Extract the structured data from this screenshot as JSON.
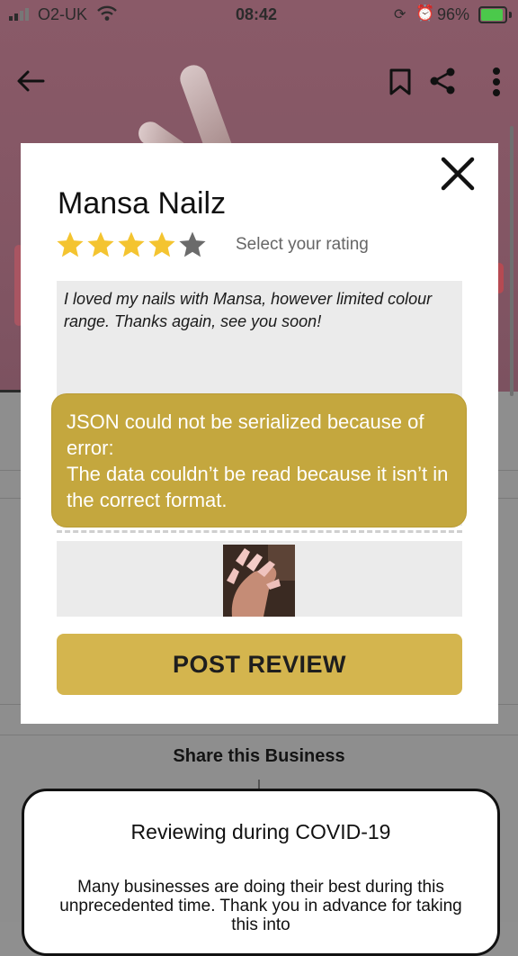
{
  "status_bar": {
    "carrier": "O2-UK",
    "time": "08:42",
    "battery": "96%"
  },
  "nav": {
    "back_icon": "arrow-left-icon",
    "bookmark_icon": "bookmark-icon",
    "share_icon": "share-icon",
    "more_icon": "more-vertical-icon"
  },
  "review_modal": {
    "business_name": "Mansa Nailz",
    "rating": 4,
    "rating_max": 5,
    "rating_hint": "Select your rating",
    "review_text": "I loved my nails with Mansa, however limited colour range. Thanks again, see you soon!",
    "post_button_label": "POST REVIEW"
  },
  "error_toast": {
    "line1": "JSON could not be serialized because of error:",
    "line2": "The data couldn’t be read because it isn’t in the correct format."
  },
  "share": {
    "label": "Share this Business"
  },
  "covid_notice": {
    "title": "Reviewing during COVID-19",
    "body": "Many businesses are doing their best during this unprecedented time. Thank you in advance for taking this into"
  },
  "colors": {
    "accent_gold": "#d4b54e",
    "toast_gold": "#c4a73e",
    "star_filled": "#f4c430",
    "star_empty": "#6b6b6b"
  }
}
